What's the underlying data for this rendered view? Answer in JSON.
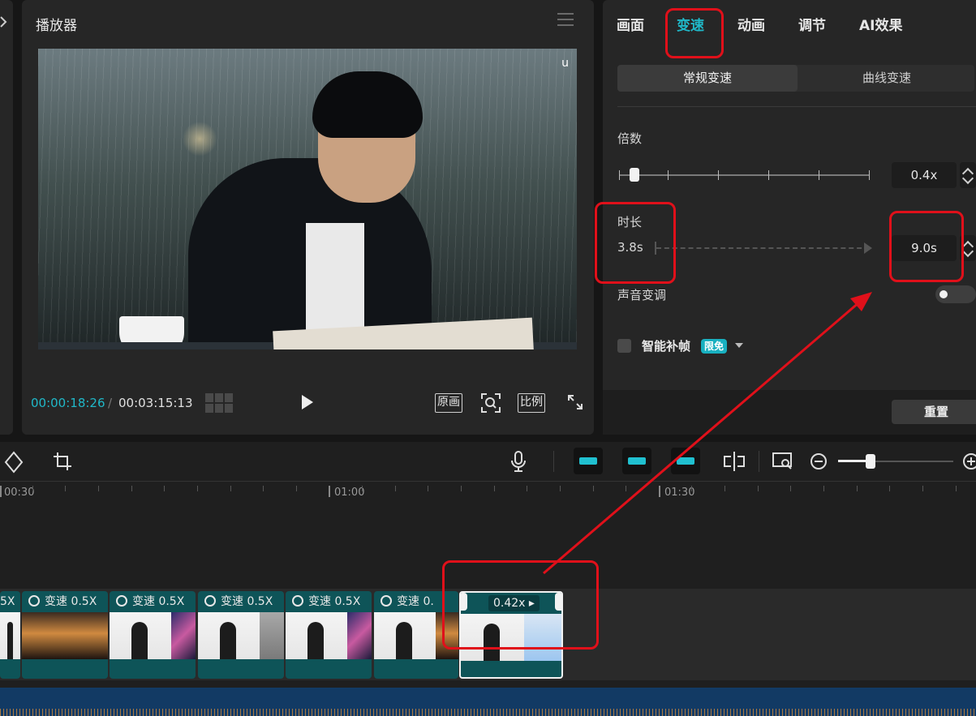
{
  "player": {
    "title": "播放器",
    "watermark": "u",
    "time_current": "00:00:18:26",
    "time_separator": "/",
    "time_total": "00:03:15:13",
    "btn_original": "原画",
    "btn_ratio": "比例"
  },
  "props": {
    "tabs": [
      "画面",
      "变速",
      "动画",
      "调节",
      "AI效果"
    ],
    "active_tab": "变速",
    "seg_normal": "常规变速",
    "seg_curve": "曲线变速",
    "multiplier_label": "倍数",
    "multiplier_value": "0.4x",
    "duration_label": "时长",
    "duration_from": "3.8s",
    "duration_to": "9.0s",
    "pitch_label": "声音变调",
    "pitch_enabled": false,
    "smart_frame_label": "智能补帧",
    "smart_frame_badge": "限免",
    "smart_frame_checked": false,
    "reset_label": "重置"
  },
  "timeline": {
    "ruler": [
      "00:30",
      "01:00",
      "01:30"
    ],
    "clips": [
      {
        "label": "5X"
      },
      {
        "label": "变速 0.5X"
      },
      {
        "label": "变速 0.5X"
      },
      {
        "label": "变速 0.5X"
      },
      {
        "label": "变速 0.5X"
      },
      {
        "label": "变速 0."
      },
      {
        "label": "0.42x ▸"
      }
    ]
  },
  "colors": {
    "accent": "#20b8c8",
    "highlight": "#e0101a",
    "clip": "#0e5458"
  },
  "icons": [
    "arrow-right-icon",
    "menu-icon",
    "grid-icon",
    "play-icon",
    "zoom-fit-icon",
    "fullscreen-icon",
    "mirror-icon",
    "crop-icon",
    "mic-icon",
    "link-left-icon",
    "link-center-icon",
    "link-right-icon",
    "split-icon",
    "preview-search-icon",
    "zoom-out-icon",
    "zoom-in-icon",
    "speed-icon"
  ]
}
